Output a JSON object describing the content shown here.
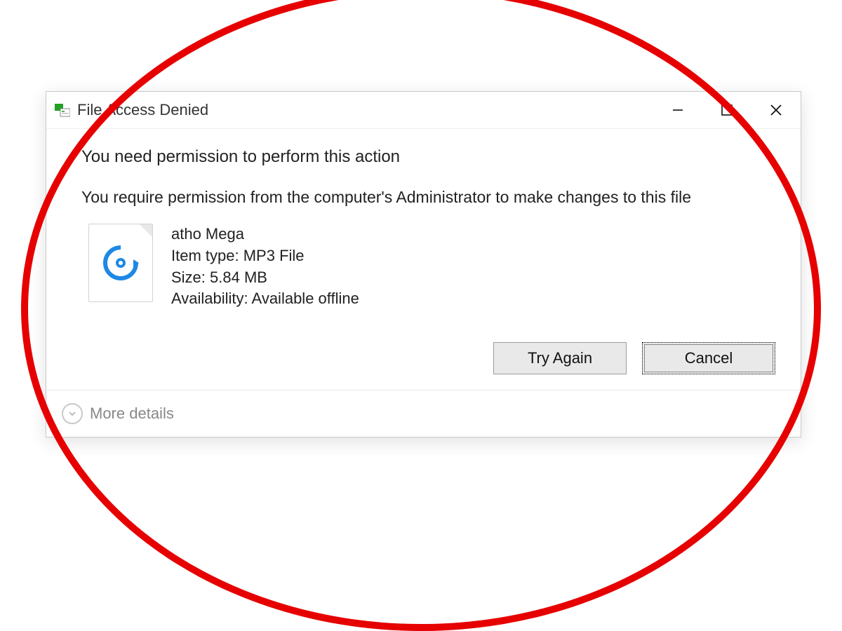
{
  "titlebar": {
    "title": "File Access Denied"
  },
  "message": {
    "heading": "You need permission to perform this action",
    "body": "You require permission from the computer's Administrator to make changes to this file"
  },
  "file": {
    "name": "atho Mega",
    "type_label": "Item type: ",
    "type_value": "MP3 File",
    "size_label": "Size: ",
    "size_value": "5.84 MB",
    "avail_label": "Availability: ",
    "avail_value": "Available offline"
  },
  "buttons": {
    "try_again": "Try Again",
    "cancel": "Cancel"
  },
  "footer": {
    "more_details": "More details"
  }
}
